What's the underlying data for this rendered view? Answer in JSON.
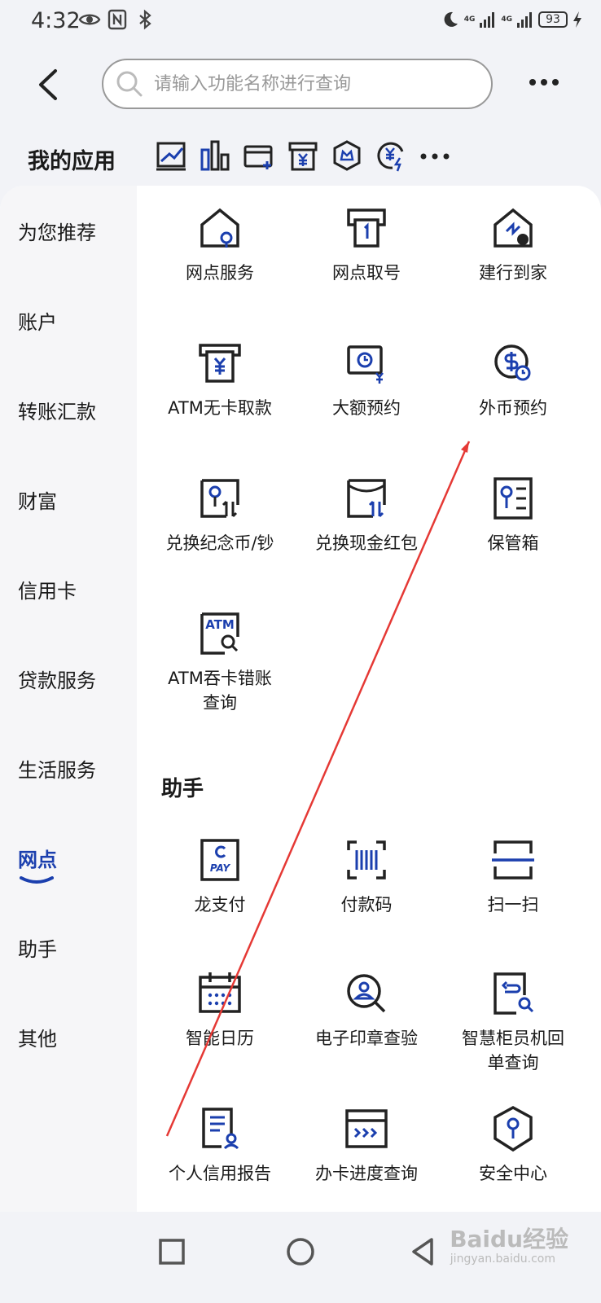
{
  "status": {
    "time": "4:32",
    "net1": "4G",
    "net2": "4G",
    "battery": "93"
  },
  "search": {
    "placeholder": "请输入功能名称进行查询"
  },
  "my_apps": {
    "title": "我的应用",
    "icons": [
      "chart-trend-icon",
      "bar-chart-icon",
      "card-add-icon",
      "yuan-box-icon",
      "crown-shield-icon",
      "yuan-flash-icon",
      "more-dots-icon"
    ]
  },
  "sidebar": {
    "items": [
      {
        "label": "为您推荐"
      },
      {
        "label": "账户"
      },
      {
        "label": "转账汇款"
      },
      {
        "label": "财富"
      },
      {
        "label": "信用卡"
      },
      {
        "label": "贷款服务"
      },
      {
        "label": "生活服务"
      },
      {
        "label": "网点",
        "active": true
      },
      {
        "label": "助手"
      },
      {
        "label": "其他"
      }
    ]
  },
  "branch_section": {
    "items": [
      {
        "label": "网点服务",
        "icon": "house-location-icon"
      },
      {
        "label": "网点取号",
        "icon": "queue-ticket-icon"
      },
      {
        "label": "建行到家",
        "icon": "house-delivery-icon"
      },
      {
        "label": "ATM无卡取款",
        "icon": "atm-cash-icon"
      },
      {
        "label": "大额预约",
        "icon": "large-amount-clock-icon"
      },
      {
        "label": "外币预约",
        "icon": "foreign-currency-clock-icon"
      },
      {
        "label": "兑换纪念币/钞",
        "icon": "coin-exchange-icon"
      },
      {
        "label": "兑换现金红包",
        "icon": "red-packet-exchange-icon"
      },
      {
        "label": "保管箱",
        "icon": "safe-box-icon"
      },
      {
        "label": "ATM吞卡错账\n查询",
        "icon": "atm-search-icon"
      }
    ]
  },
  "assistant_section": {
    "title": "助手",
    "items": [
      {
        "label": "龙支付",
        "icon": "long-pay-icon"
      },
      {
        "label": "付款码",
        "icon": "barcode-scan-icon"
      },
      {
        "label": "扫一扫",
        "icon": "scan-icon"
      },
      {
        "label": "智能日历",
        "icon": "calendar-icon"
      },
      {
        "label": "电子印章查验",
        "icon": "seal-check-icon"
      },
      {
        "label": "智慧柜员机回\n单查询",
        "icon": "receipt-search-icon"
      },
      {
        "label": "个人信用报告",
        "icon": "credit-report-icon"
      },
      {
        "label": "办卡进度查询",
        "icon": "card-progress-icon"
      },
      {
        "label": "安全中心",
        "icon": "security-shield-icon"
      }
    ]
  },
  "watermark": {
    "main": "Baidu经验",
    "sub": "jingyan.baidu.com"
  },
  "colors": {
    "accent": "#1b3fae",
    "annotation": "#e53935"
  }
}
